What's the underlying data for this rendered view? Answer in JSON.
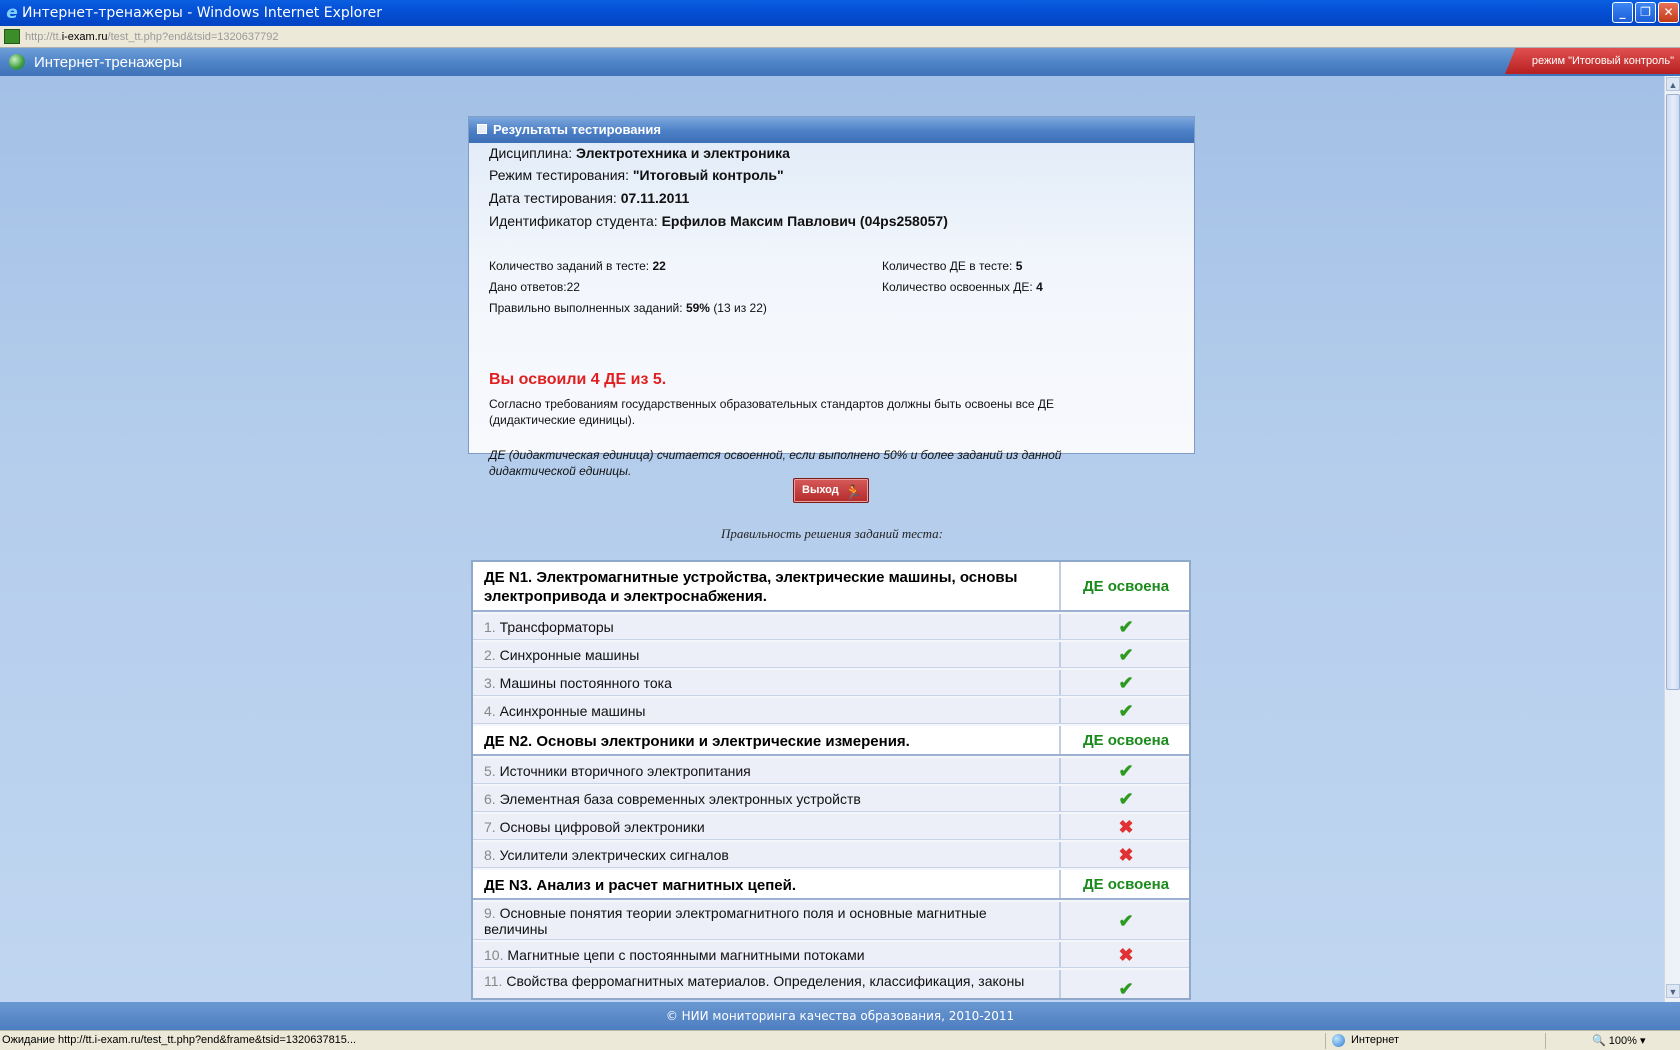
{
  "window": {
    "title": "Интернет-тренажеры - Windows Internet Explorer",
    "url_prefix": "http://tt.",
    "url_domain": "i-exam.ru",
    "url_path": "/test_tt.php?end&tsid=1320637792"
  },
  "header": {
    "app_title": "Интернет-тренажеры",
    "mode_badge": "режим \"Итоговый контроль\""
  },
  "panel": {
    "title": "Результаты тестирования",
    "discipline_label": "Дисциплина:",
    "discipline": "Электротехника и электроника",
    "mode_label": "Режим тестирования:",
    "mode": "\"Итоговый контроль\"",
    "date_label": "Дата тестирования:",
    "date": "07.11.2011",
    "student_label": "Идентификатор студента:",
    "student": "Ерфилов Максим Павлович (04ps258057)",
    "tasks_label": "Количество заданий в тесте:",
    "tasks": "22",
    "answers_label": "Дано ответов:",
    "answers": "22",
    "correct_label": "Правильно выполненных заданий:",
    "correct_pct": "59%",
    "correct_detail": "(13 из 22)",
    "de_total_label": "Количество ДЕ в тесте:",
    "de_total": "5",
    "de_mastered_label": "Количество освоенных ДЕ:",
    "de_mastered": "4",
    "mastered_msg": "Вы освоили 4 ДЕ из 5.",
    "note1": "Согласно требованиям государственных образовательных стандартов должны быть освоены все ДЕ (дидактические единицы).",
    "note2": "ДЕ (дидактическая единица) считается освоенной, если выполнено 50% и более заданий из данной дидактической единицы."
  },
  "exit_button": {
    "label": "Выход"
  },
  "caption": "Правильность решения заданий теста:",
  "table": {
    "groups": [
      {
        "title": "ДЕ N1. Электромагнитные устройства, электрические машины, основы электропривода и электроснабжения.",
        "status": "ДЕ освоена",
        "tasks": [
          {
            "num": "1.",
            "name": "Трансформаторы",
            "ok": true
          },
          {
            "num": "2.",
            "name": "Синхронные машины",
            "ok": true
          },
          {
            "num": "3.",
            "name": "Машины постоянного тока",
            "ok": true
          },
          {
            "num": "4.",
            "name": "Асинхронные машины",
            "ok": true
          }
        ]
      },
      {
        "title": "ДЕ N2. Основы электроники и электрические измерения.",
        "status": "ДЕ освоена",
        "tasks": [
          {
            "num": "5.",
            "name": "Источники вторичного электропитания",
            "ok": true
          },
          {
            "num": "6.",
            "name": "Элементная база современных электронных устройств",
            "ok": true
          },
          {
            "num": "7.",
            "name": "Основы цифровой электроники",
            "ok": false
          },
          {
            "num": "8.",
            "name": "Усилители электрических сигналов",
            "ok": false
          }
        ]
      },
      {
        "title": "ДЕ N3. Анализ и расчет магнитных цепей.",
        "status": "ДЕ освоена",
        "tasks": [
          {
            "num": "9.",
            "name": "Основные понятия теории электромагнитного поля и основные магнитные величины",
            "ok": true
          },
          {
            "num": "10.",
            "name": "Магнитные цепи с постоянными магнитными потоками",
            "ok": false
          },
          {
            "num": "11.",
            "name": "Свойства ферромагнитных материалов. Определения, классификация, законы",
            "ok": true
          }
        ]
      }
    ]
  },
  "footer": "© НИИ мониторинга качества образования, 2010-2011",
  "statusbar": {
    "text": "Ожидание http://tt.i-exam.ru/test_tt.php?end&frame&tsid=1320637815...",
    "zone": "Интернет",
    "zoom": "100%"
  },
  "icons": {
    "ok": "check-icon",
    "bad": "cross-icon"
  },
  "colors": {
    "status_ok": "#1a8a1a",
    "mastered_msg": "#e02020"
  }
}
